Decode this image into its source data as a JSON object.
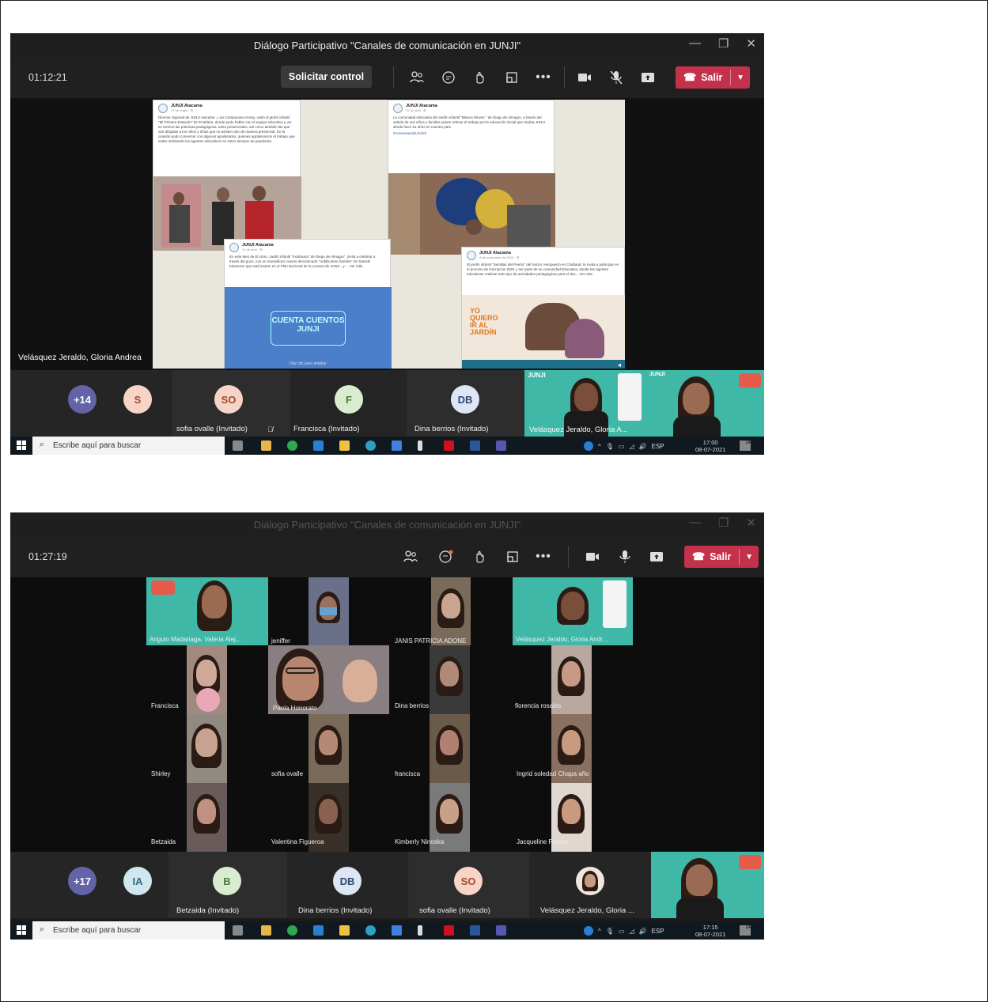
{
  "screenshots": [
    {
      "window_title": "Diálogo Participativo \"Canales de comunicación en JUNJI\"",
      "timer": "01:12:21",
      "request_control_label": "Solicitar control",
      "leave_label": "Salir",
      "speaker_name": "Velásquez Jeraldo, Gloria Andrea",
      "shared_posts": [
        {
          "author": "JUNJI Atacama",
          "date": "27 de mayo · ⚙",
          "text": "Director regional de JUNJI Atacama , Luis Campusano Kemp, visitó el jardín infantil \"Mi Primera Estación\" de #Caldera, donde pudo hablar con el equipo educativo y ver en terreno las prácticas pedagógicas, tanto presenciales, así como también las que van dirigidas a los niños y niñas que no asisten aún de manera presencial. En la ocasión pudo conversar con algunos apoderados, quienes agradecieron el trabajo que están realizando los agentes educativos en estos tiempos de pandemia."
        },
        {
          "author": "JUNJI Atacama",
          "date": "22 de abril · ⚙",
          "text": "La comunidad educativa del Jardín infantil \"Blanca Nieves \" de Diego de Almagro, a través del saludo de sus niños y familias quiere relevar el trabajo por la educación inicial que realiza JUNJI desde hace 51 años en nuestro país.",
          "hashtag": "#Aniversario51JUNJI"
        },
        {
          "author": "JUNJI Atacama",
          "date": "21 de abril · ⚙",
          "text": "En este Mes de El Libro, Jardín infantil \"Incahuara\" de Diego de Almagro\", invita a celebrar a través del goce, con un maravilloso cuento denominado \"Ardilla tiene hambre\" de Satoshi Kitamura; que está inserto en el Plan Nacional de la Lectura de JUNJI , y ... Ver más",
          "banner": "CUENTA CUENTOS JUNJI",
          "banner_sub": "Haz clic para ampliar"
        },
        {
          "author": "JUNJI Atacama",
          "date": "4 de noviembre de 2020 · ⚙",
          "text": "El jardín infantil \"Semillas del Puerto\" del Sector Aeropuerto en Chañaral, te invita a participar en el proceso de inscripción 2021 y ser parte de su comunidad Educativa, donde las agentes educativas realizan todo tipo de actividades pedagógicas para el des... Ver más",
          "banner": "YO QUIERO IR AL JARDÍN"
        }
      ],
      "participants_strip": [
        {
          "initials": "+14",
          "name": "",
          "color": "#6264a7"
        },
        {
          "initials": "S",
          "name": "",
          "color": "#f6d5c7"
        },
        {
          "initials": "SO",
          "name": "sofia ovalle (Invitado)",
          "color": "#f6d5c7"
        },
        {
          "initials": "F",
          "name": "Francisca (Invitado)",
          "color": "#d9ecd0"
        },
        {
          "initials": "DB",
          "name": "Dina berrios (Invitado)",
          "color": "#dde6f2"
        }
      ],
      "video_tiles": [
        {
          "name": "Velásquez Jeraldo, Gloria A...",
          "logo": "JUNJI"
        },
        {
          "name": "",
          "logo": "JUNJI"
        }
      ],
      "taskbar": {
        "search_placeholder": "Escribe aquí para buscar",
        "lang": "ESP",
        "time": "17:00",
        "date": "08-07-2021",
        "notif": "14"
      }
    },
    {
      "window_title": "Diálogo Participativo \"Canales de comunicación en JUNJI\"",
      "timer": "01:27:19",
      "leave_label": "Salir",
      "gallery": [
        {
          "name": "Angulo Madariaga, Valeria Alej...",
          "style": "teal"
        },
        {
          "name": "jeniffer",
          "style": "dark"
        },
        {
          "name": "JANIS PATRICIA ADONE",
          "style": "dark"
        },
        {
          "name": "Velásquez Jeraldo, Gloria Andr...",
          "style": "teal"
        },
        {
          "name": "Francisca",
          "style": "dark"
        },
        {
          "name": "Paola Honorato",
          "style": "dark"
        },
        {
          "name": "Dina berrios",
          "style": "dark"
        },
        {
          "name": "florencia rosales",
          "style": "dark"
        },
        {
          "name": "Shirley",
          "style": "dark"
        },
        {
          "name": "sofia ovalle",
          "style": "dark"
        },
        {
          "name": "francisca",
          "style": "dark"
        },
        {
          "name": "Ingrid soledad Chapa año",
          "style": "dark"
        },
        {
          "name": "Betzaida",
          "style": "dark"
        },
        {
          "name": "Valentina Figueroa",
          "style": "dark"
        },
        {
          "name": "Kimberly Ninoska",
          "style": "dark"
        },
        {
          "name": "Jacqueline Pizarro",
          "style": "dark"
        }
      ],
      "participants_strip": [
        {
          "initials": "+17",
          "name": "",
          "color": "#6264a7"
        },
        {
          "initials": "IA",
          "name": "",
          "color": "#d0e7ef"
        },
        {
          "initials": "B",
          "name": "Betzaida (Invitado)",
          "color": "#d9ecd0"
        },
        {
          "initials": "DB",
          "name": "Dina berrios (Invitado)",
          "color": "#dde6f2"
        },
        {
          "initials": "SO",
          "name": "sofia ovalle (Invitado)",
          "color": "#f6d5c7"
        },
        {
          "initials": "",
          "name": "Velásquez Jeraldo, Gloria ...",
          "color": "#f0e6e0"
        }
      ],
      "taskbar": {
        "search_placeholder": "Escribe aquí para buscar",
        "lang": "ESP",
        "time": "17:15",
        "date": "08-07-2021",
        "notif": "14"
      }
    }
  ],
  "colors": {
    "teams_bg": "#1b1b1b",
    "leave_red": "#c4314b",
    "teams_purple": "#6264a7",
    "junji_teal": "#3fb8a8"
  },
  "icons": [
    "people-icon",
    "chat-icon",
    "reactions-icon",
    "rooms-icon",
    "more-icon",
    "camera-icon",
    "mic-icon",
    "share-icon",
    "phone-icon",
    "chevron-down-icon",
    "mic-off-icon",
    "search-icon",
    "windows-icon"
  ]
}
